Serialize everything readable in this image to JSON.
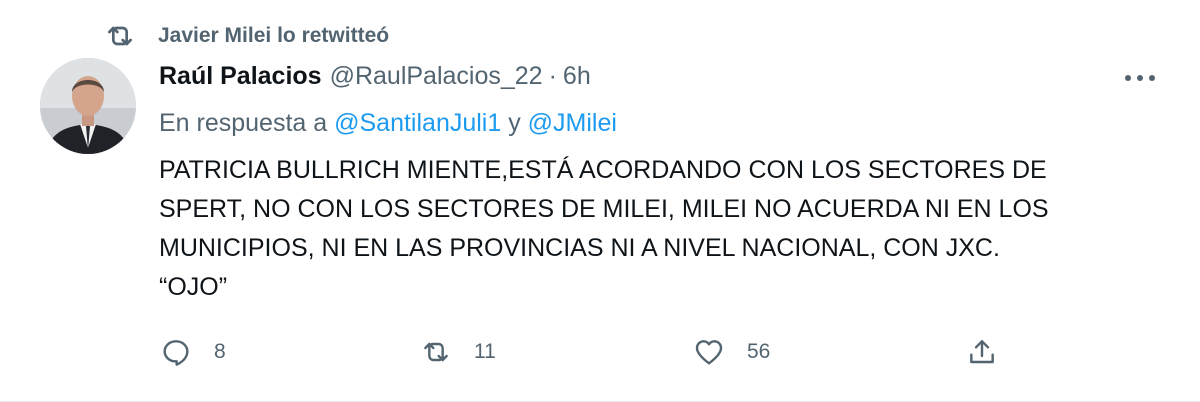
{
  "retweet_context": {
    "label": "Javier Milei lo retwitteó",
    "icon": "retweet-icon"
  },
  "tweet": {
    "author_name": "Raúl Palacios",
    "author_handle": "@RaulPalacios_22",
    "separator": "·",
    "time": "6h",
    "reply_prefix": "En respuesta a",
    "reply_mentions": [
      "@SantilanJuli1",
      "@JMilei"
    ],
    "reply_joiner": "y",
    "text_lines": [
      "PATRICIA BULLRICH MIENTE,ESTÁ ACORDANDO CON LOS SECTORES DE",
      "SPERT, NO CON LOS SECTORES DE MILEI, MILEI NO ACUERDA NI EN LOS",
      "MUNICIPIOS, NI EN LAS PROVINCIAS NI A NIVEL NACIONAL, CON JXC.",
      "“OJO”"
    ]
  },
  "actions": {
    "replies": "8",
    "retweets": "11",
    "likes": "56"
  },
  "colors": {
    "text": "#0f1419",
    "secondary": "#536471",
    "accent": "#1d9bf0"
  }
}
